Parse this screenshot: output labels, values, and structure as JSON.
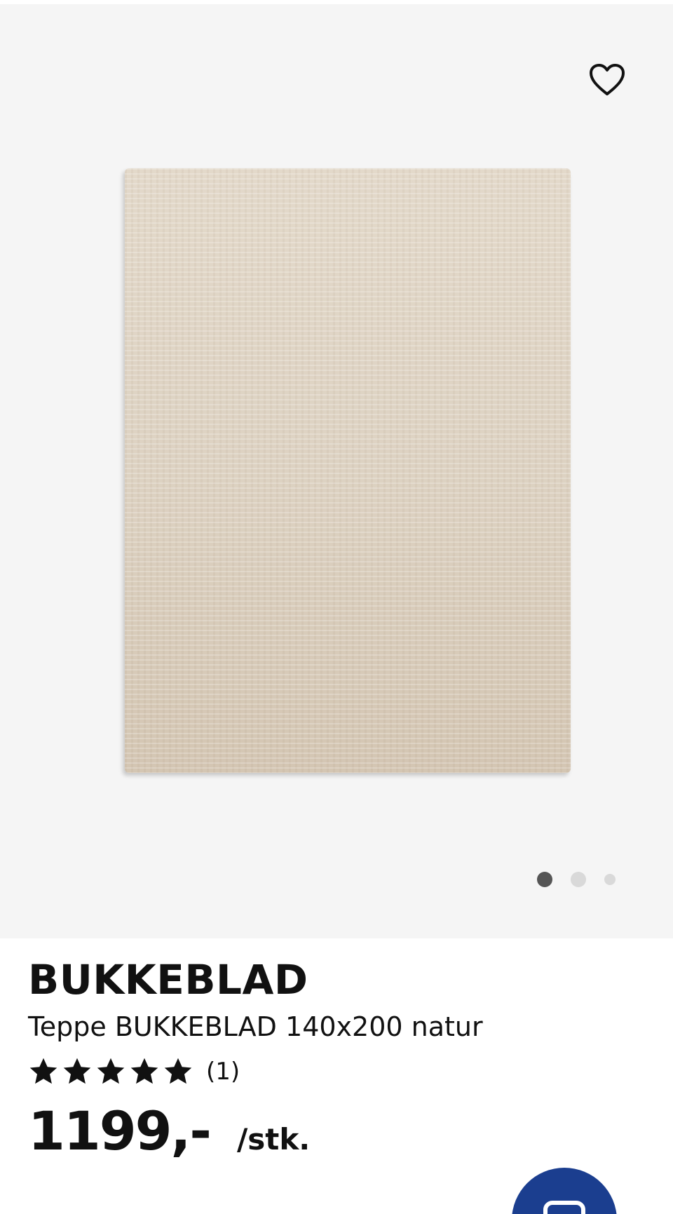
{
  "product": {
    "brand": "BUKKEBLAD",
    "description": "Teppe BUKKEBLAD 140x200 natur",
    "rating": {
      "stars": 5,
      "max_stars": 5,
      "review_count": "(1)"
    },
    "price": "1199,-",
    "price_unit": "/stk."
  },
  "gallery": {
    "image_count": 3,
    "active_index": 0
  },
  "icons": {
    "favorite": "heart-outline-icon",
    "star": "star-filled-icon",
    "chat": "chat-bubble-icon"
  },
  "colors": {
    "image_background": "#f5f5f5",
    "chat_button": "#1b3e8f",
    "active_dot": "#555555",
    "inactive_dot": "#d9d9d9"
  }
}
